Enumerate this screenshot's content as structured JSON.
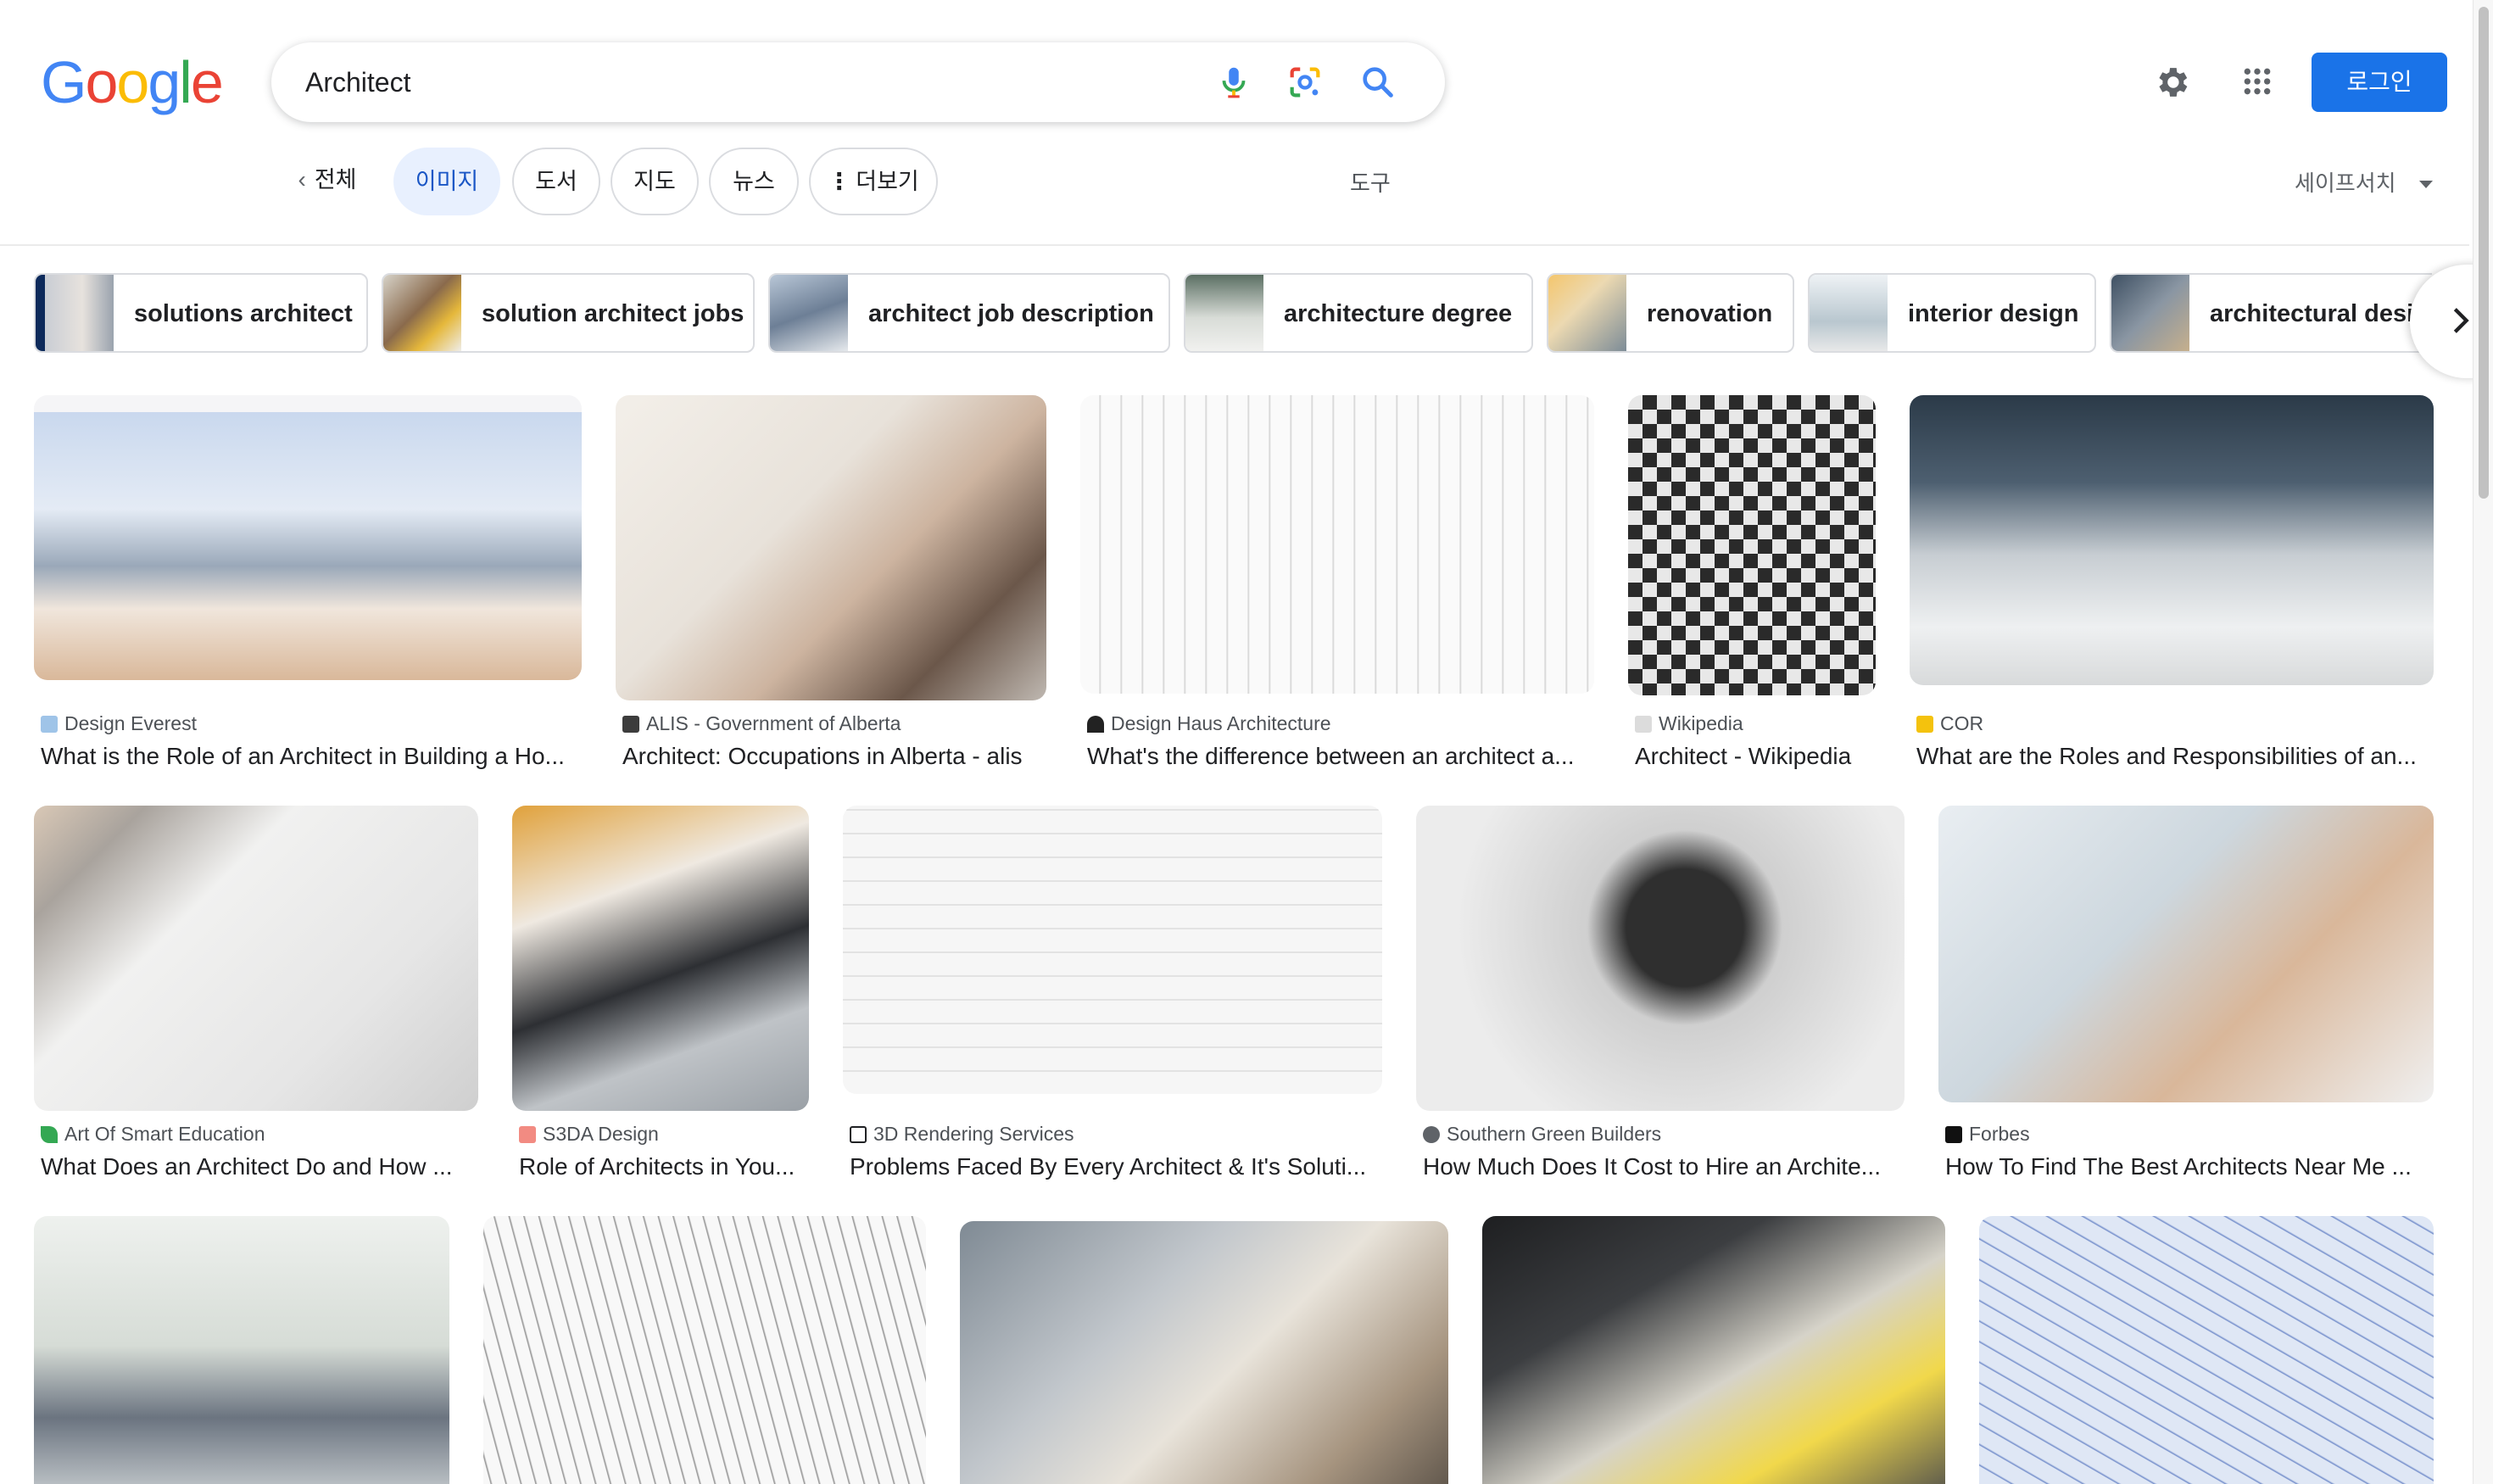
{
  "logo": {
    "letters": [
      "G",
      "o",
      "o",
      "g",
      "l",
      "e"
    ],
    "colors": [
      "#4285F4",
      "#EA4335",
      "#FBBC05",
      "#4285F4",
      "#34A853",
      "#EA4335"
    ]
  },
  "search": {
    "query": "Architect"
  },
  "header": {
    "login_label": "로그인"
  },
  "tabs": [
    {
      "label": "전체"
    },
    {
      "label": "이미지"
    },
    {
      "label": "도서"
    },
    {
      "label": "지도"
    },
    {
      "label": "뉴스"
    },
    {
      "label": "더보기"
    }
  ],
  "tools_label": "도구",
  "safesearch_label": "세이프서치",
  "chips": [
    {
      "label": "solutions architect"
    },
    {
      "label": "solution architect jobs"
    },
    {
      "label": "architect job description"
    },
    {
      "label": "architecture degree"
    },
    {
      "label": "renovation"
    },
    {
      "label": "interior design"
    },
    {
      "label": "architectural desi"
    }
  ],
  "results": [
    {
      "source": "Design Everest",
      "title": "What is the Role of an Architect in Building a Ho..."
    },
    {
      "source": "ALIS - Government of Alberta",
      "title": "Architect: Occupations in Alberta - alis"
    },
    {
      "source": "Design Haus Architecture",
      "title": "What's the difference between an architect a..."
    },
    {
      "source": "Wikipedia",
      "title": "Architect - Wikipedia"
    },
    {
      "source": "COR",
      "title": "What are the Roles and Responsibilities of an..."
    },
    {
      "source": "Art Of Smart Education",
      "title": "What Does an Architect Do and How ..."
    },
    {
      "source": "S3DA Design",
      "title": "Role of Architects in You..."
    },
    {
      "source": "3D Rendering Services",
      "title": "Problems Faced By Every Architect & It's Soluti..."
    },
    {
      "source": "Southern Green Builders",
      "title": "How Much Does It Cost to Hire an Archite..."
    },
    {
      "source": "Forbes",
      "title": "How To Find The Best Architects Near Me ..."
    }
  ]
}
